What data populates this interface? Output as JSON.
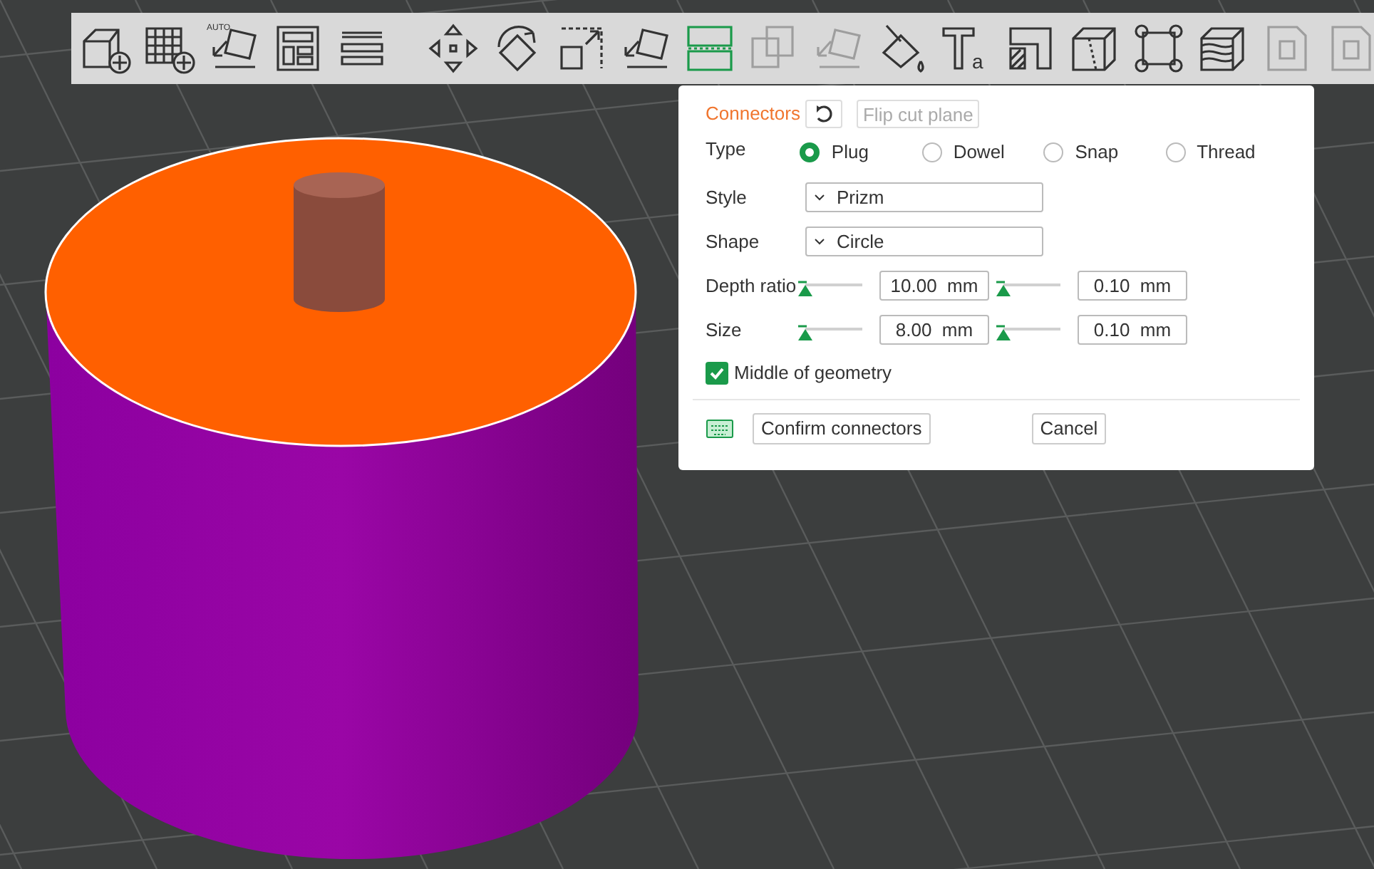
{
  "toolbar": [
    {
      "kind": "add-cube",
      "selected": false,
      "disabled": false
    },
    {
      "kind": "add-plate",
      "selected": false,
      "disabled": false
    },
    {
      "kind": "auto-orient",
      "selected": false,
      "disabled": false,
      "badge": "AUTO"
    },
    {
      "kind": "arrange",
      "selected": false,
      "disabled": false
    },
    {
      "kind": "layers",
      "selected": false,
      "disabled": false
    },
    {
      "kind": "separator"
    },
    {
      "kind": "move",
      "selected": false,
      "disabled": false
    },
    {
      "kind": "rotate",
      "selected": false,
      "disabled": false
    },
    {
      "kind": "scale",
      "selected": false,
      "disabled": false
    },
    {
      "kind": "lay-on-face",
      "selected": false,
      "disabled": false
    },
    {
      "kind": "cut",
      "selected": true,
      "disabled": false
    },
    {
      "kind": "boolean",
      "selected": false,
      "disabled": true
    },
    {
      "kind": "lay-on-face",
      "selected": false,
      "disabled": true
    },
    {
      "kind": "paint",
      "selected": false,
      "disabled": false
    },
    {
      "kind": "text",
      "selected": false,
      "disabled": false,
      "badge": "a"
    },
    {
      "kind": "emboss",
      "selected": false,
      "disabled": false
    },
    {
      "kind": "seam",
      "selected": false,
      "disabled": false
    },
    {
      "kind": "support",
      "selected": false,
      "disabled": false
    },
    {
      "kind": "fuzzy",
      "selected": false,
      "disabled": false
    },
    {
      "kind": "page",
      "selected": false,
      "disabled": true
    },
    {
      "kind": "page",
      "selected": false,
      "disabled": true
    }
  ],
  "panel": {
    "title": "Connectors",
    "flip_button": "Flip cut plane",
    "type": {
      "label": "Type",
      "options": [
        {
          "label": "Plug",
          "selected": true
        },
        {
          "label": "Dowel",
          "selected": false
        },
        {
          "label": "Snap",
          "selected": false
        },
        {
          "label": "Thread",
          "selected": false
        }
      ]
    },
    "style": {
      "label": "Style",
      "value": "Prizm"
    },
    "shape": {
      "label": "Shape",
      "value": "Circle"
    },
    "sliders": [
      {
        "label": "Depth ratio",
        "main": {
          "level": 0,
          "value": "10.00  mm"
        },
        "tolerance": {
          "level": 0,
          "value": "0.10  mm"
        }
      },
      {
        "label": "Size",
        "main": {
          "level": 0,
          "value": "8.00  mm"
        },
        "tolerance": {
          "level": 0,
          "value": "0.10  mm"
        }
      }
    ],
    "middle_of_geometry": {
      "label": "Middle of geometry",
      "checked": true
    },
    "confirm_button": "Confirm connectors",
    "cancel_button": "Cancel"
  }
}
